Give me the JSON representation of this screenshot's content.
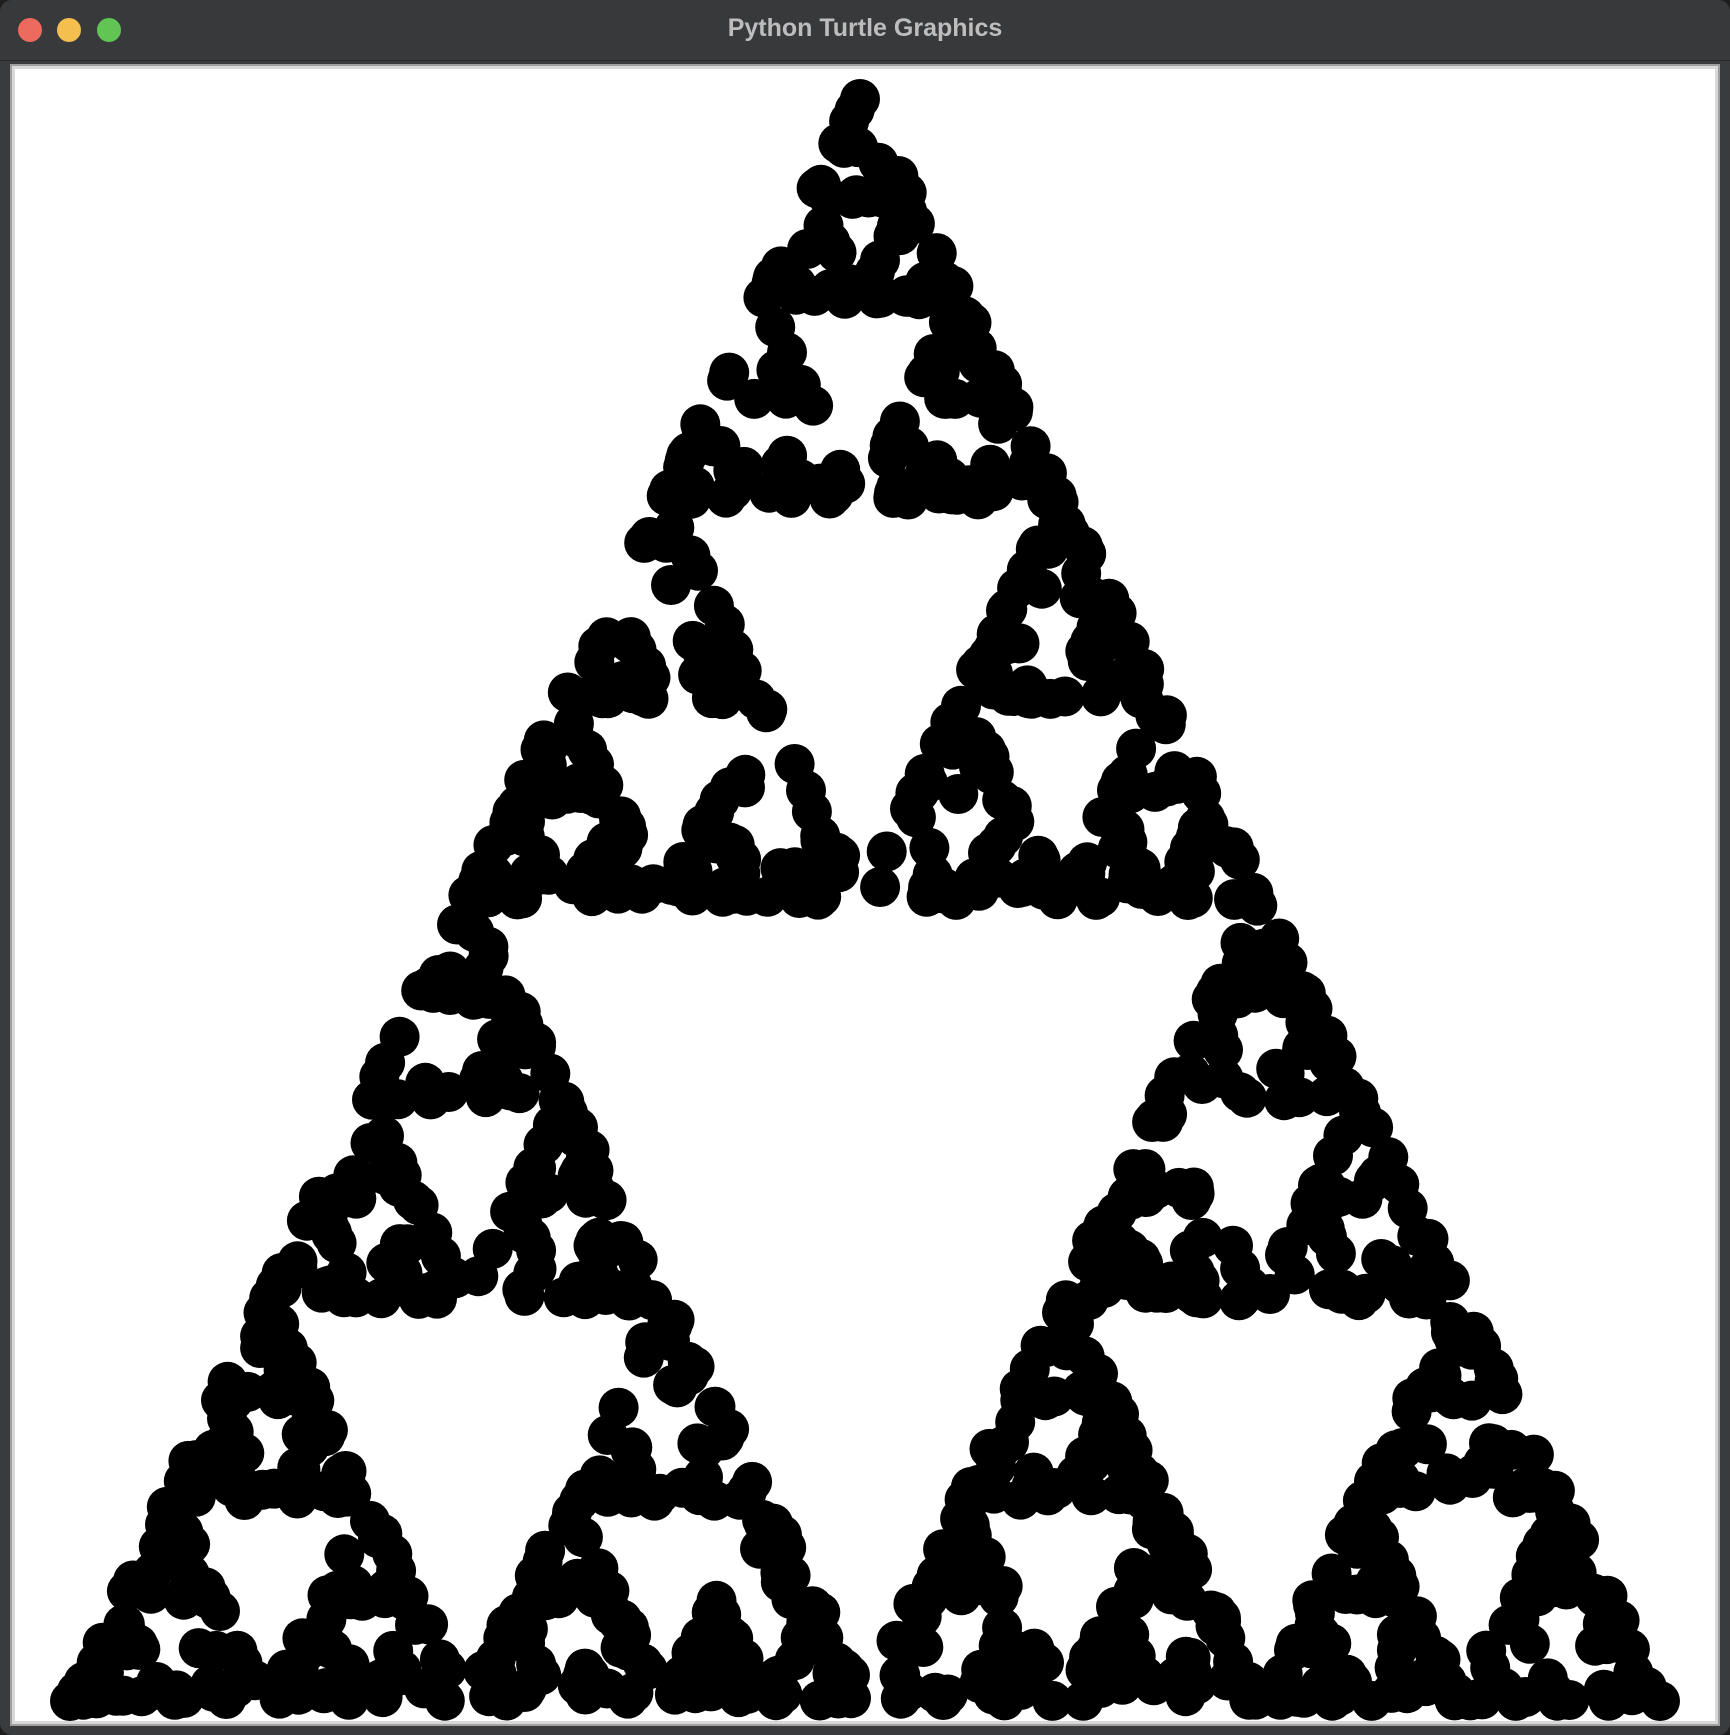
{
  "window": {
    "title": "Python Turtle Graphics"
  },
  "colors": {
    "titlebar": "#38393b",
    "close": "#ed6a5e",
    "minimize": "#f5bf4f",
    "zoom": "#61c554",
    "canvas_bg": "#ffffff",
    "dot": "#000000"
  },
  "icons": {
    "close": "close-traffic-light-icon",
    "minimize": "minimize-traffic-light-icon",
    "zoom": "zoom-traffic-light-icon"
  },
  "drawing": {
    "shape": "sierpinski-triangle",
    "mark": "dot"
  }
}
